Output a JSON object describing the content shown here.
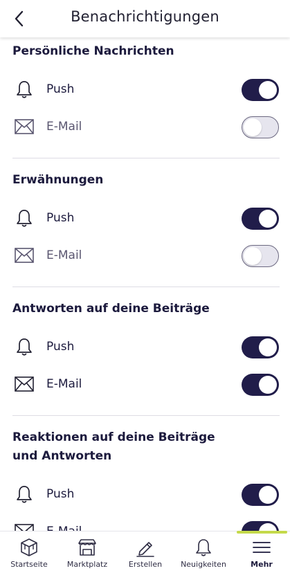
{
  "header": {
    "title": "Benachrichtigungen"
  },
  "sections": [
    {
      "title": "Persönliche Nachrichten",
      "rows": [
        {
          "label": "Push",
          "enabled": true
        },
        {
          "label": "E-Mail",
          "enabled": false
        }
      ]
    },
    {
      "title": "Erwähnungen",
      "rows": [
        {
          "label": "Push",
          "enabled": true
        },
        {
          "label": "E-Mail",
          "enabled": false
        }
      ]
    },
    {
      "title": "Antworten auf deine Beiträge",
      "rows": [
        {
          "label": "Push",
          "enabled": true
        },
        {
          "label": "E-Mail",
          "enabled": true
        }
      ]
    },
    {
      "title": "Reaktionen auf deine Beiträge und Antworten",
      "rows": [
        {
          "label": "Push",
          "enabled": true
        },
        {
          "label": "E-Mail",
          "enabled": true
        }
      ]
    }
  ],
  "bottom_nav": {
    "items": [
      {
        "label": "Startseite",
        "icon": "home-cube-icon",
        "active": false
      },
      {
        "label": "Marktplatz",
        "icon": "market-stall-icon",
        "active": false
      },
      {
        "label": "Erstellen",
        "icon": "pencil-icon",
        "active": false
      },
      {
        "label": "Neuigkeiten",
        "icon": "bell-icon",
        "active": false
      },
      {
        "label": "Mehr",
        "icon": "menu-icon",
        "active": true
      }
    ]
  },
  "colors": {
    "primary": "#211d4a",
    "accent": "#c4d94a",
    "toggle_off": "#e6e5ee"
  }
}
